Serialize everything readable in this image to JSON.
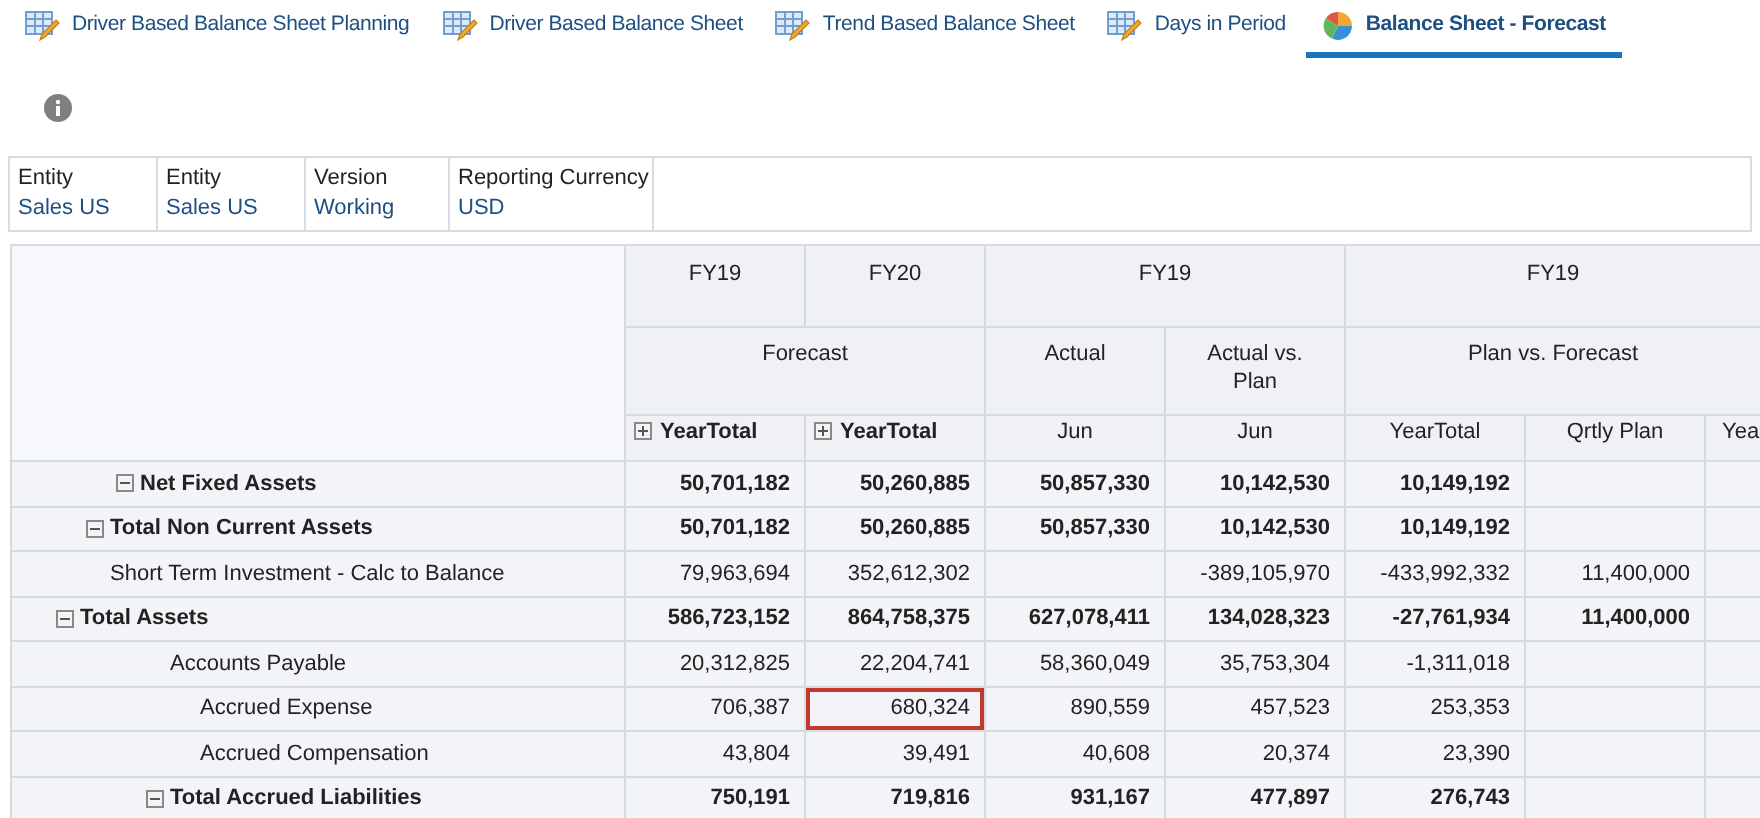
{
  "tabs": [
    {
      "label": "Driver Based Balance Sheet Planning",
      "kind": "form",
      "selected": false
    },
    {
      "label": "Driver Based Balance Sheet",
      "kind": "form",
      "selected": false
    },
    {
      "label": "Trend Based Balance Sheet",
      "kind": "form",
      "selected": false
    },
    {
      "label": "Days in Period",
      "kind": "form",
      "selected": false
    },
    {
      "label": "Balance Sheet - Forecast",
      "kind": "chart",
      "selected": true
    }
  ],
  "pov": [
    {
      "dimension": "Entity",
      "member": "Sales US"
    },
    {
      "dimension": "Entity",
      "member": "Sales US"
    },
    {
      "dimension": "Version",
      "member": "Working"
    },
    {
      "dimension": "Reporting Currency",
      "member": "USD"
    }
  ],
  "grid": {
    "year_headers": [
      {
        "label": "FY19"
      },
      {
        "label": "FY20"
      },
      {
        "label": "FY19"
      },
      {
        "label": "FY19"
      }
    ],
    "scenario_headers": [
      {
        "label": "Forecast"
      },
      {
        "label": "Actual"
      },
      {
        "label": "Actual vs. Plan"
      },
      {
        "label": "Plan vs. Forecast"
      }
    ],
    "period_headers": [
      {
        "label": "YearTotal",
        "expanded": false
      },
      {
        "label": "YearTotal",
        "expanded": false
      },
      {
        "label": "Jun"
      },
      {
        "label": "Jun"
      },
      {
        "label": "YearTotal"
      },
      {
        "label": "Qrtly Plan"
      },
      {
        "label": "Yea"
      }
    ],
    "asset_rows": [
      {
        "label": "Total Assets",
        "expanded": true,
        "bold": true,
        "cells": [
          {
            "text": "586,723,152",
            "selected": false
          },
          {
            "text": "864,758,375",
            "selected": false
          },
          {
            "text": "627,078,411",
            "selected": false
          },
          {
            "text": "134,028,323",
            "selected": false
          },
          {
            "text": "-27,761,934",
            "selected": false
          },
          {
            "text": "11,400,000",
            "selected": false
          },
          {
            "selected": false
          }
        ],
        "children": [
          {
            "label": "Total Non Current Assets",
            "expanded": true,
            "bold": true,
            "cells": [
              {
                "text": "50,701,182",
                "selected": false
              },
              {
                "text": "50,260,885",
                "selected": false
              },
              {
                "text": "50,857,330",
                "selected": false
              },
              {
                "text": "10,142,530",
                "selected": false
              },
              {
                "text": "10,149,192",
                "selected": false
              },
              {
                "selected": false
              },
              {
                "selected": false
              }
            ],
            "children": [
              {
                "label": "Net Fixed Assets",
                "expanded": true,
                "bold": true,
                "cells": [
                  {
                    "text": "50,701,182",
                    "selected": false
                  },
                  {
                    "text": "50,260,885",
                    "selected": false
                  },
                  {
                    "text": "50,857,330",
                    "selected": false
                  },
                  {
                    "text": "10,142,530",
                    "selected": false
                  },
                  {
                    "text": "10,149,192",
                    "selected": false
                  },
                  {
                    "selected": false
                  },
                  {
                    "selected": false
                  }
                ]
              }
            ]
          },
          {
            "label": "Short Term Investment - Calc to Balance",
            "bold": false,
            "cells": [
              {
                "text": "79,963,694",
                "selected": false
              },
              {
                "text": "352,612,302",
                "selected": false
              },
              {
                "selected": false
              },
              {
                "text": "-389,105,970",
                "selected": false
              },
              {
                "text": "-433,992,332",
                "selected": false
              },
              {
                "text": "11,400,000",
                "selected": false
              },
              {
                "selected": false
              }
            ]
          }
        ]
      }
    ],
    "liability_rows": [
      {
        "label": "Accounts Payable",
        "bold": false,
        "cells": [
          {
            "text": "20,312,825",
            "selected": false
          },
          {
            "text": "22,204,741",
            "selected": false
          },
          {
            "text": "58,360,049",
            "selected": false
          },
          {
            "text": "35,753,304",
            "selected": false
          },
          {
            "text": "-1,311,018",
            "selected": false
          },
          {
            "selected": false
          },
          {
            "selected": false
          }
        ]
      },
      {
        "label": "Total Accrued Liabilities",
        "expanded": true,
        "bold": true,
        "cells": [
          {
            "text": "750,191",
            "selected": false
          },
          {
            "text": "719,816",
            "selected": false
          },
          {
            "text": "931,167",
            "selected": false
          },
          {
            "text": "477,897",
            "selected": false
          },
          {
            "text": "276,743",
            "selected": false
          },
          {
            "selected": false
          },
          {
            "selected": false
          }
        ],
        "children": [
          {
            "label": "Accrued Expense",
            "bold": false,
            "cells": [
              {
                "text": "706,387",
                "selected": false
              },
              {
                "text": "680,324",
                "selected": true
              },
              {
                "text": "890,559",
                "selected": false
              },
              {
                "text": "457,523",
                "selected": false
              },
              {
                "text": "253,353",
                "selected": false
              },
              {
                "selected": false
              },
              {
                "selected": false
              }
            ]
          },
          {
            "label": "Accrued Compensation",
            "bold": false,
            "cells": [
              {
                "text": "43,804",
                "selected": false
              },
              {
                "text": "39,491",
                "selected": false
              },
              {
                "text": "40,608",
                "selected": false
              },
              {
                "text": "20,374",
                "selected": false
              },
              {
                "text": "23,390",
                "selected": false
              },
              {
                "selected": false
              },
              {
                "selected": false
              }
            ]
          }
        ]
      }
    ]
  }
}
